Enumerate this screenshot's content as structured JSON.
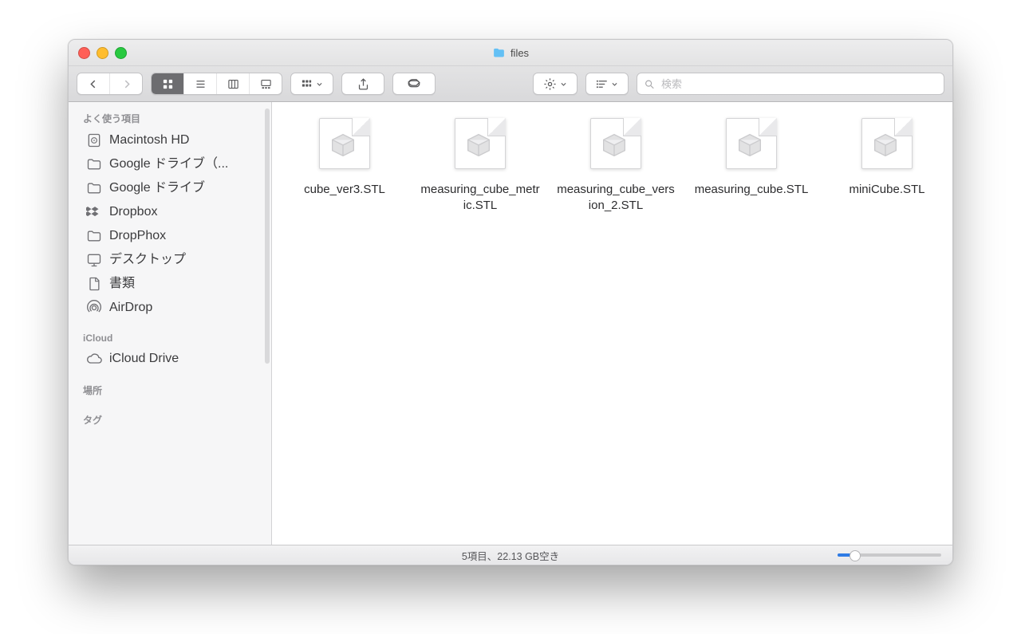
{
  "window": {
    "title": "files"
  },
  "search": {
    "placeholder": "検索"
  },
  "sidebar": {
    "groups": [
      {
        "title": "よく使う項目",
        "items": [
          {
            "icon": "hdd",
            "label": "Macintosh HD"
          },
          {
            "icon": "folder",
            "label": "Google ドライブ（..."
          },
          {
            "icon": "folder",
            "label": "Google ドライブ"
          },
          {
            "icon": "dropbox",
            "label": "Dropbox"
          },
          {
            "icon": "folder",
            "label": "DropPhox"
          },
          {
            "icon": "desktop",
            "label": "デスクトップ"
          },
          {
            "icon": "doc",
            "label": "書類"
          },
          {
            "icon": "airdrop",
            "label": "AirDrop"
          }
        ]
      },
      {
        "title": "iCloud",
        "items": [
          {
            "icon": "cloud",
            "label": "iCloud Drive"
          }
        ]
      },
      {
        "title": "場所",
        "items": []
      },
      {
        "title": "タグ",
        "items": []
      }
    ]
  },
  "files": [
    {
      "name": "cube_ver3.STL"
    },
    {
      "name": "measuring_cube_metric.STL"
    },
    {
      "name": "measuring_cube_version_2.STL"
    },
    {
      "name": "measuring_cube.STL"
    },
    {
      "name": "miniCube.STL"
    }
  ],
  "status": {
    "text": "5項目、22.13 GB空き"
  }
}
